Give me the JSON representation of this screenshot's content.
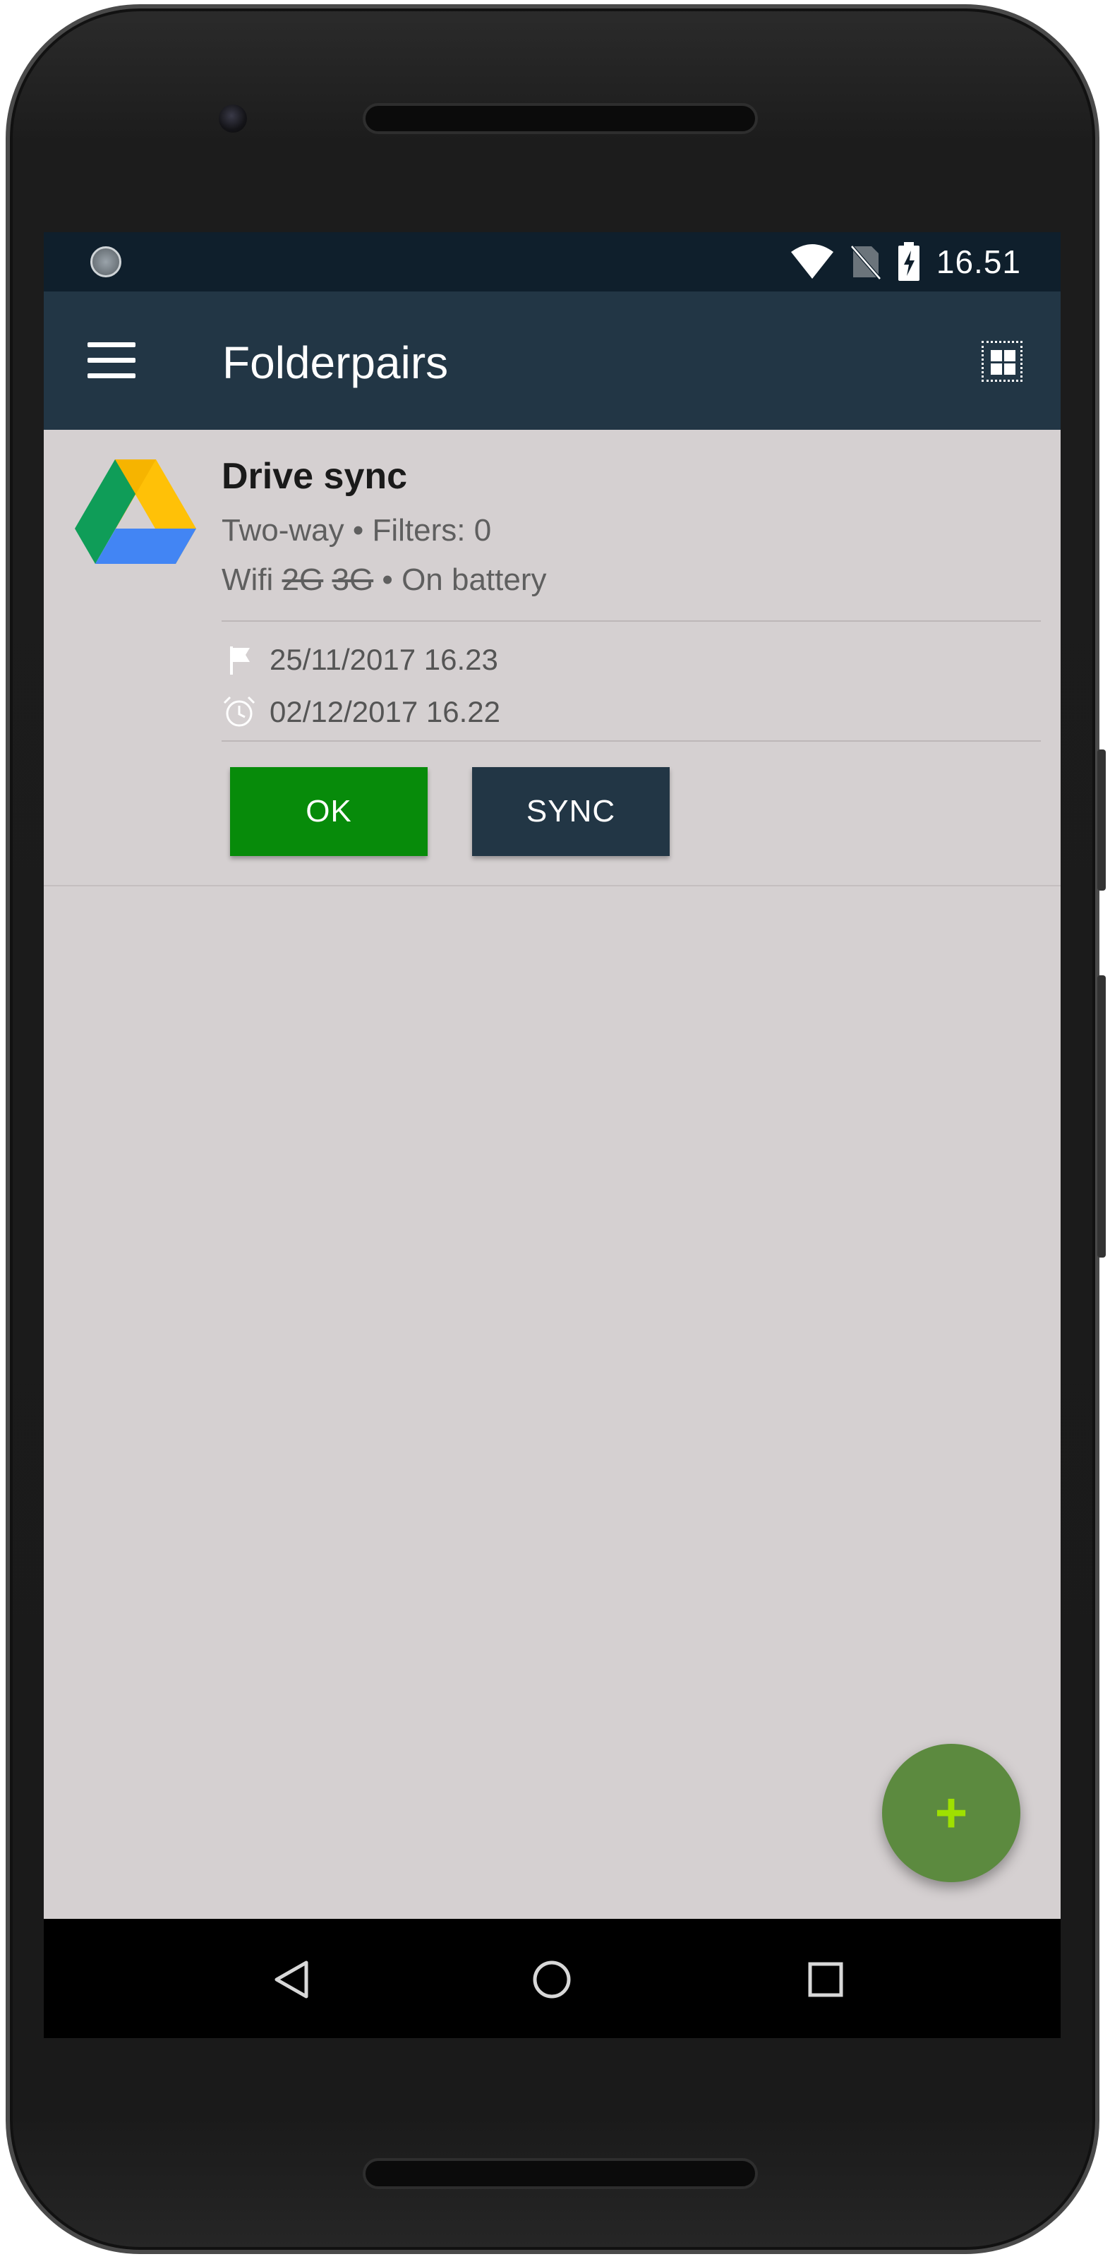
{
  "status_bar": {
    "time": "16.51",
    "icons": [
      "wifi-icon",
      "no-sim-icon",
      "battery-charging-icon"
    ]
  },
  "app_bar": {
    "title": "Folderpairs",
    "menu_icon": "hamburger-menu-icon",
    "view_toggle_icon": "grid-view-icon"
  },
  "folderpair": {
    "icon": "google-drive-icon",
    "name": "Drive sync",
    "sync_type": "Two-way",
    "separator": "•",
    "filters": "Filters: 0",
    "connection_wifi": "Wifi",
    "connection_2g": "2G",
    "connection_3g": "3G",
    "power": "On battery",
    "last_sync": "25/11/2017 16.23",
    "next_sync": "02/12/2017 16.22",
    "status_label": "OK",
    "sync_label": "SYNC",
    "colors": {
      "ok": "#078b0a",
      "sync": "#223645"
    }
  },
  "fab": {
    "label": "+",
    "icon": "add-icon",
    "color": "#5c8a3f"
  },
  "nav_bar": {
    "icons": [
      "back-icon",
      "home-icon",
      "recents-icon"
    ]
  },
  "theme": {
    "primary": "#223645",
    "status_bar": "#0f1f2c",
    "background": "#d5d0d1"
  }
}
